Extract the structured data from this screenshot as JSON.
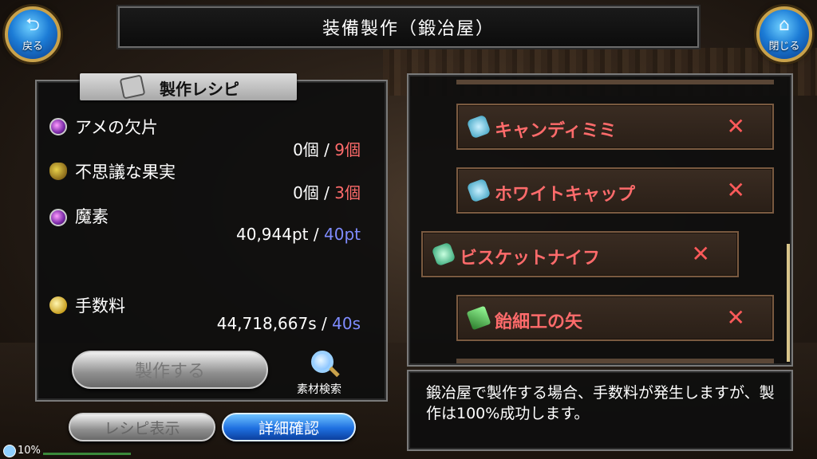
{
  "nav": {
    "back_label": "戻る",
    "close_label": "閉じる"
  },
  "title": "装備製作（鍛冶屋）",
  "recipe_panel": {
    "header": "製作レシピ",
    "materials": [
      {
        "name": "アメの欠片",
        "owned": "0個",
        "separator": "/",
        "required": "9個",
        "icon": "purple-orb-icon"
      },
      {
        "name": "不思議な果実",
        "owned": "0個",
        "separator": "/",
        "required": "3個",
        "icon": "fruit-icon"
      },
      {
        "name": "魔素",
        "owned": "40,944pt",
        "separator": "/",
        "required": "40pt",
        "icon": "purple-orb-icon"
      }
    ],
    "fee": {
      "name": "手数料",
      "owned": "44,718,667s",
      "separator": "/",
      "required": "40s",
      "icon": "coins-icon"
    },
    "craft_button": "製作する",
    "material_search": "素材検索",
    "recipe_display_button": "レシピ表示",
    "detail_button": "詳細確認"
  },
  "recipe_list": [
    {
      "name": "キャンディミミ",
      "status": "✕",
      "icon": "hat-icon"
    },
    {
      "name": "ホワイトキャップ",
      "status": "✕",
      "icon": "hat-icon"
    },
    {
      "name": "ビスケットナイフ",
      "status": "✕",
      "icon": "knife-icon",
      "selected": true
    },
    {
      "name": "飴細工の矢",
      "status": "✕",
      "icon": "arrow-icon"
    }
  ],
  "info_text": "鍛冶屋で製作する場合、手数料が発生しますが、製作は100%成功します。",
  "status": {
    "percent_label": "10%"
  },
  "colors": {
    "insufficient": "#ff6b6b",
    "magic": "#7f8cff",
    "accent_blue": "#1e6fe0"
  }
}
